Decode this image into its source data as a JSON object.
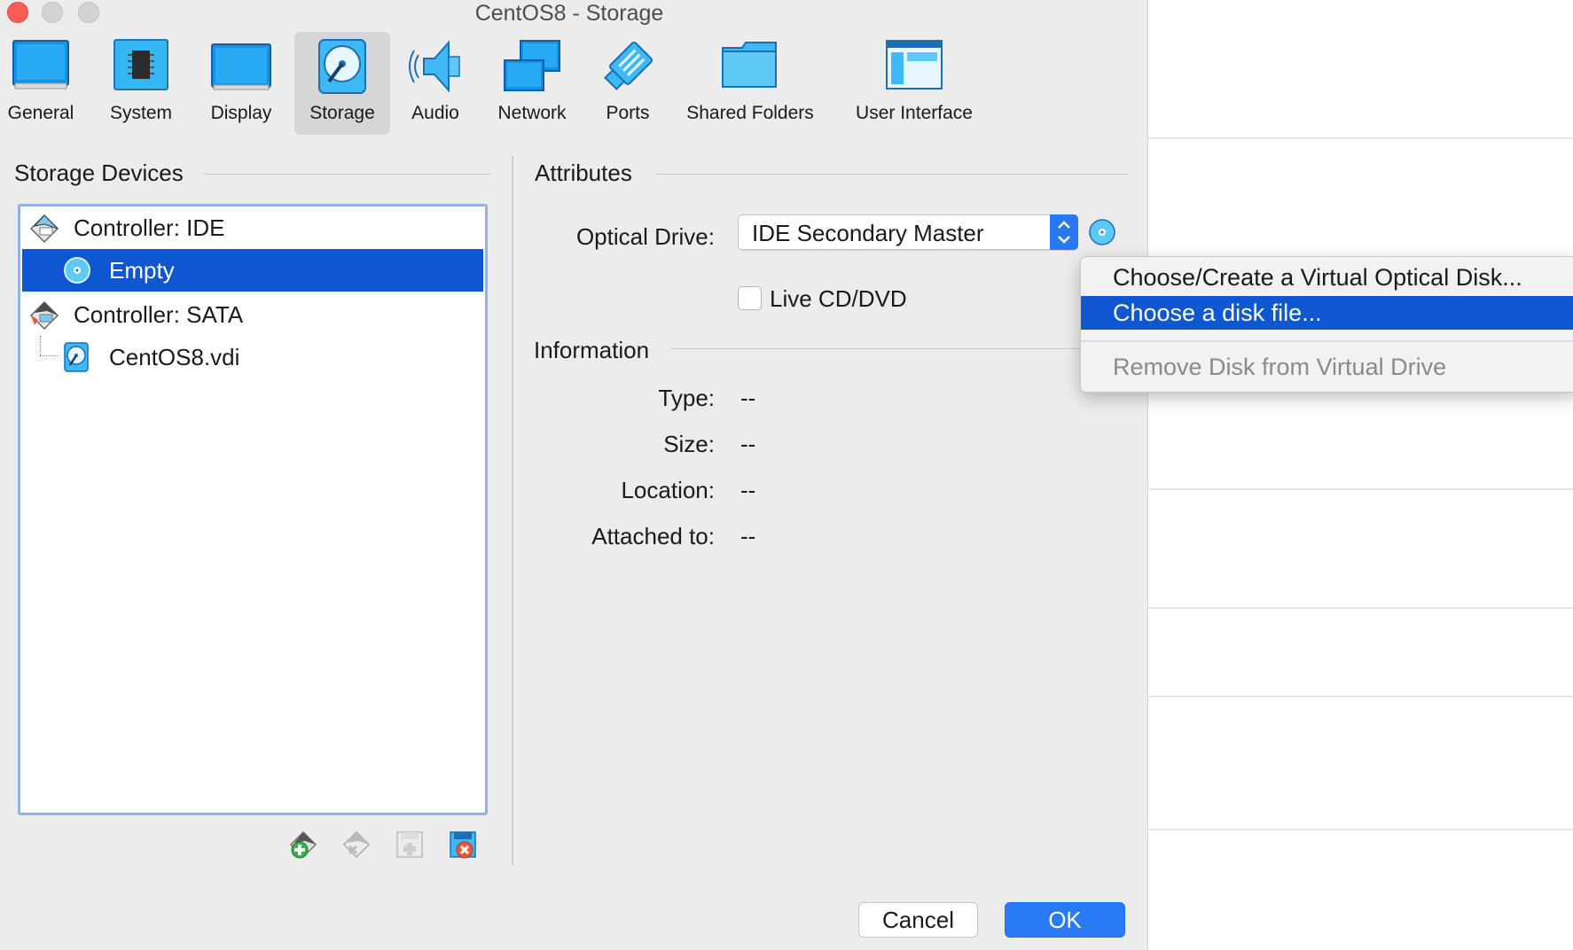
{
  "window": {
    "title": "CentOS8 - Storage"
  },
  "toolbar": {
    "items": [
      {
        "label": "General",
        "icon": "general-icon"
      },
      {
        "label": "System",
        "icon": "system-icon"
      },
      {
        "label": "Display",
        "icon": "display-icon"
      },
      {
        "label": "Storage",
        "icon": "storage-icon",
        "selected": true
      },
      {
        "label": "Audio",
        "icon": "audio-icon"
      },
      {
        "label": "Network",
        "icon": "network-icon"
      },
      {
        "label": "Ports",
        "icon": "ports-icon"
      },
      {
        "label": "Shared Folders",
        "icon": "shared-folders-icon"
      },
      {
        "label": "User Interface",
        "icon": "user-interface-icon"
      }
    ]
  },
  "storage": {
    "title": "Storage Devices",
    "tree": [
      {
        "label": "Controller: IDE",
        "icon": "ide-controller-icon",
        "level": 0
      },
      {
        "label": "Empty",
        "icon": "optical-disc-icon",
        "level": 1,
        "selected": true
      },
      {
        "label": "Controller: SATA",
        "icon": "sata-controller-icon",
        "level": 0
      },
      {
        "label": "CentOS8.vdi",
        "icon": "hard-disk-icon",
        "level": 1
      }
    ],
    "actions": [
      "add-attachment-icon",
      "remove-attachment-icon",
      "add-controller-icon",
      "remove-controller-icon"
    ]
  },
  "attributes": {
    "title": "Attributes",
    "optical_drive_label": "Optical Drive:",
    "optical_drive_value": "IDE Secondary Master",
    "live_cd_label": "Live CD/DVD",
    "live_cd_checked": false
  },
  "information": {
    "title": "Information",
    "type_label": "Type:",
    "type_value": "--",
    "size_label": "Size:",
    "size_value": "--",
    "location_label": "Location:",
    "location_value": "--",
    "attached_label": "Attached to:",
    "attached_value": "--"
  },
  "menu": {
    "items": [
      {
        "label": "Choose/Create a Virtual Optical Disk..."
      },
      {
        "label": "Choose a disk file...",
        "highlighted": true
      },
      {
        "label": "Remove Disk from Virtual Drive",
        "disabled": true
      }
    ]
  },
  "buttons": {
    "cancel": "Cancel",
    "ok": "OK"
  },
  "colors": {
    "selection": "#0f57d1",
    "accent": "#2a7af5",
    "icon_blue": "#18a0f0"
  }
}
